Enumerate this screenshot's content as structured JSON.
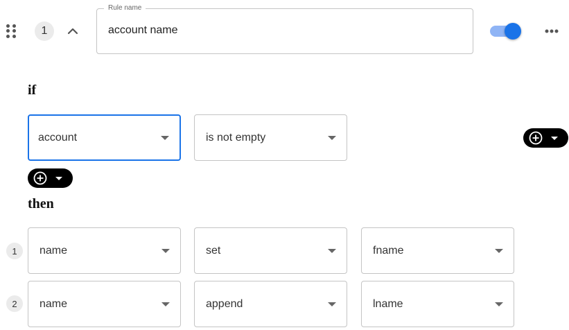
{
  "rule": {
    "index": "1",
    "name_label": "Rule name",
    "name_value": "account name",
    "enabled": true
  },
  "if_section": {
    "heading": "if",
    "condition": {
      "field": "account",
      "operator": "is not empty"
    }
  },
  "then_section": {
    "heading": "then",
    "actions": [
      {
        "index": "1",
        "field": "name",
        "operation": "set",
        "value": "fname"
      },
      {
        "index": "2",
        "field": "name",
        "operation": "append",
        "value": "lname"
      }
    ]
  },
  "colors": {
    "accent": "#1a73e8",
    "toggle_track": "#8fb4f5",
    "pill_bg": "#000000"
  },
  "icons": [
    "drag-handle-icon",
    "chevron-up-icon",
    "more-horizontal-icon",
    "add-circle-icon",
    "caret-down-icon"
  ]
}
